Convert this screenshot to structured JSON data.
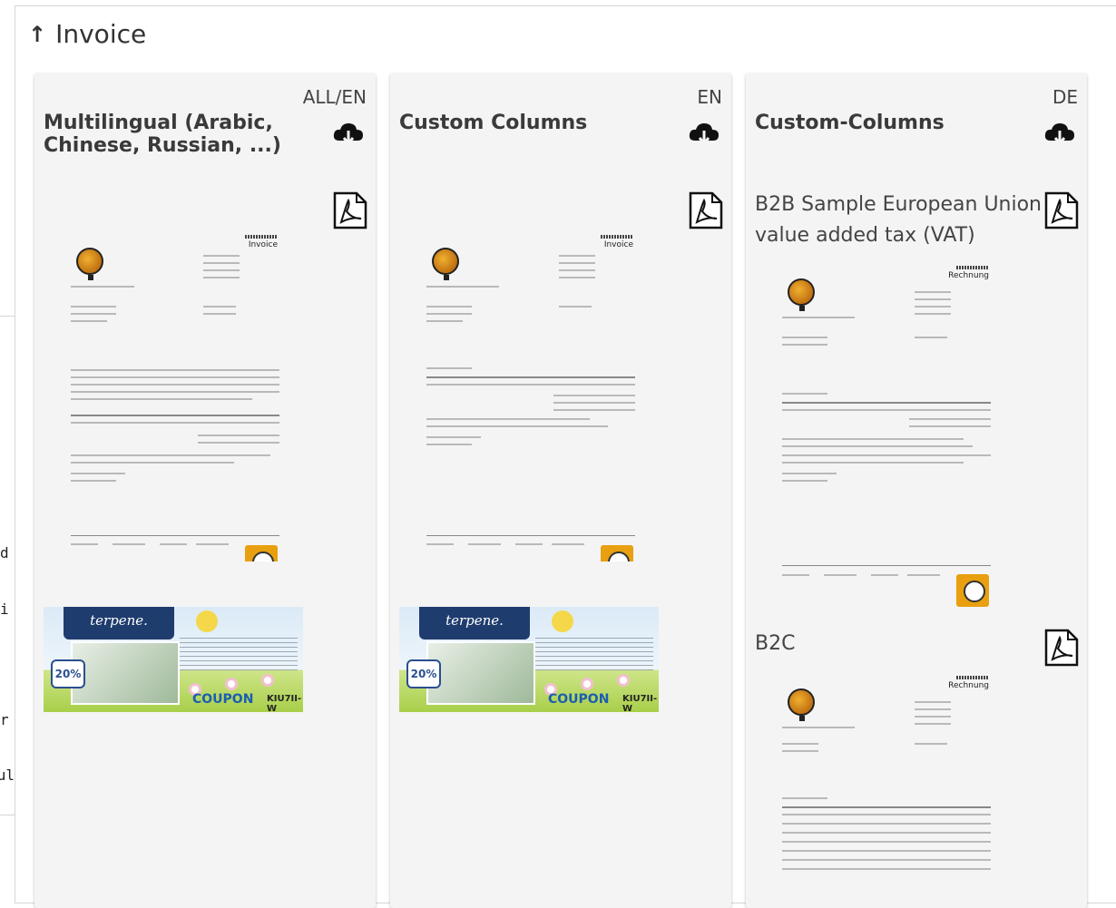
{
  "section": {
    "title": "Invoice",
    "collapse_icon": "arrow-up-icon"
  },
  "background_fragments": [
    "d",
    "i",
    "r",
    "ul"
  ],
  "cards": [
    {
      "language": "ALL/EN",
      "title": "Multilingual (Arabic, Chinese, Russian, ...)",
      "download_icon": "cloud-download-icon",
      "documents": [
        {
          "label": "",
          "icon": "pdf-icon",
          "heading": "Invoice"
        }
      ],
      "coupon": {
        "brand": "terpene.",
        "discount": "20%",
        "word": "COUPON",
        "code": "KIU7II-W"
      }
    },
    {
      "language": "EN",
      "title": "Custom Columns",
      "download_icon": "cloud-download-icon",
      "documents": [
        {
          "label": "",
          "icon": "pdf-icon",
          "heading": "Invoice"
        }
      ],
      "coupon": {
        "brand": "terpene.",
        "discount": "20%",
        "word": "COUPON",
        "code": "KIU7II-W"
      }
    },
    {
      "language": "DE",
      "title": "Custom-Columns",
      "download_icon": "cloud-download-icon",
      "documents": [
        {
          "label": "B2B Sample European Union value added tax (VAT)",
          "icon": "pdf-icon",
          "heading": "Rechnung"
        },
        {
          "label": "B2C",
          "icon": "pdf-icon",
          "heading": "Rechnung"
        }
      ]
    }
  ]
}
